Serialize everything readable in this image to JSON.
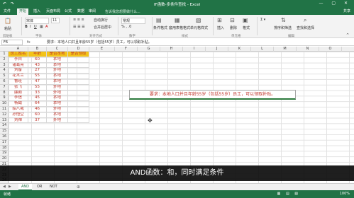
{
  "app": {
    "title": "IF函数-多条件查找 - Excel",
    "quick_access": "↶ ↷",
    "window_controls": "— ▢ ✕"
  },
  "tabs": [
    {
      "label": "文件"
    },
    {
      "label": "开始",
      "active": true
    },
    {
      "label": "插入"
    },
    {
      "label": "页面布局"
    },
    {
      "label": "公式"
    },
    {
      "label": "数据"
    },
    {
      "label": "审阅"
    },
    {
      "label": "视图"
    }
  ],
  "tell_me": "告诉我您想要做什么...",
  "share": "共享",
  "ribbon": {
    "groups": [
      "剪贴板",
      "字体",
      "对齐方式",
      "数字",
      "样式",
      "单元格",
      "编辑"
    ],
    "font_name": "宋体",
    "font_size": "11",
    "number_format": "常规",
    "buttons": [
      "粘贴",
      "自动换行",
      "合并后居中",
      "条件格式",
      "套用表格格式",
      "单元格样式",
      "插入",
      "删除",
      "格式",
      "排序和筛选",
      "查找和选择"
    ],
    "icons": [
      "paste-icon",
      "bold-icon",
      "italic-icon",
      "underline-icon",
      "align-icon",
      "percent-icon",
      "sum-icon"
    ]
  },
  "formula_bar": {
    "name_box": "F6",
    "fx": "fx",
    "content": "要求：本地人口并且年龄55岁（包括55岁）员工，可以领取补贴。"
  },
  "columns": [
    "A",
    "B",
    "C",
    "D",
    "E",
    "F",
    "G",
    "H",
    "I",
    "J",
    "K",
    "L",
    "M",
    "N",
    "O"
  ],
  "table": {
    "headers": [
      "员工姓名",
      "年龄",
      "是否本地",
      "是否领取"
    ],
    "rows": [
      [
        "李白",
        "60",
        "本地",
        ""
      ],
      [
        "诸葛亮",
        "43",
        "本地",
        ""
      ],
      [
        "刘备",
        "27",
        "外地",
        ""
      ],
      [
        "花木兰",
        "55",
        "本地",
        ""
      ],
      [
        "鲁班",
        "47",
        "本地",
        ""
      ],
      [
        "张飞",
        "55",
        "外地",
        ""
      ],
      [
        "廉颇",
        "33",
        "外地",
        ""
      ],
      [
        "李信",
        "45",
        "本地",
        ""
      ],
      [
        "杨戬",
        "64",
        "本地",
        ""
      ],
      [
        "貂八戒",
        "46",
        "外地",
        ""
      ],
      [
        "孙悟空",
        "60",
        "本地",
        ""
      ],
      [
        "刘禅",
        "37",
        "外地",
        ""
      ]
    ]
  },
  "note": "要求：本地人口并且年龄55岁（包括55岁）员工，可以领取补贴。",
  "subtitle": "AND函数：和，同时满足条件",
  "sheets": [
    {
      "label": "AND",
      "active": true
    },
    {
      "label": "OR"
    },
    {
      "label": "NOT"
    }
  ],
  "add_sheet": "⊕",
  "status": {
    "ready": "就绪",
    "zoom": "100%",
    "view_icons": "▦ ▤ ▧"
  },
  "colors": {
    "excel_green": "#217346",
    "header_fill": "#f3c318",
    "text_red": "#c0362c"
  }
}
